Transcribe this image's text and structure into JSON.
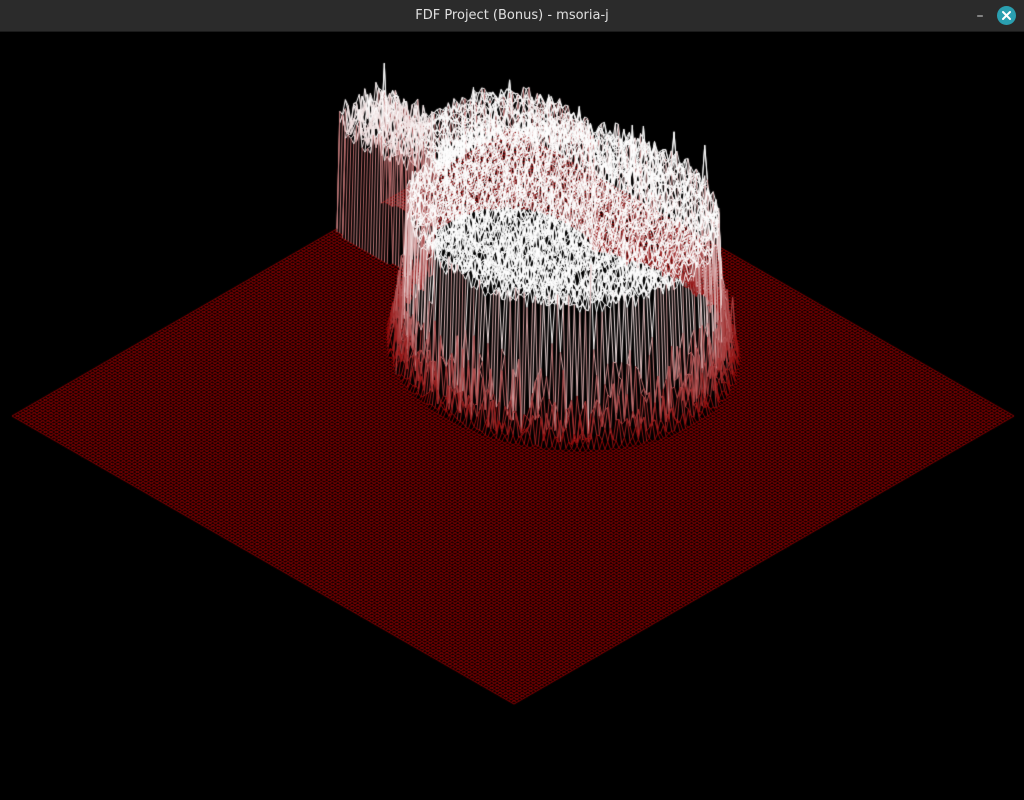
{
  "window": {
    "title": "FDF Project (Bonus) - msoria-j",
    "minimize_label": "–",
    "close_icon": "close-icon"
  },
  "render": {
    "projection": "isometric",
    "background_color": "#000000",
    "low_color": "#8b0000",
    "high_color": "#ffffff",
    "titlebar_color": "#2b2b2b",
    "close_button_color": "#2a9fb0"
  }
}
